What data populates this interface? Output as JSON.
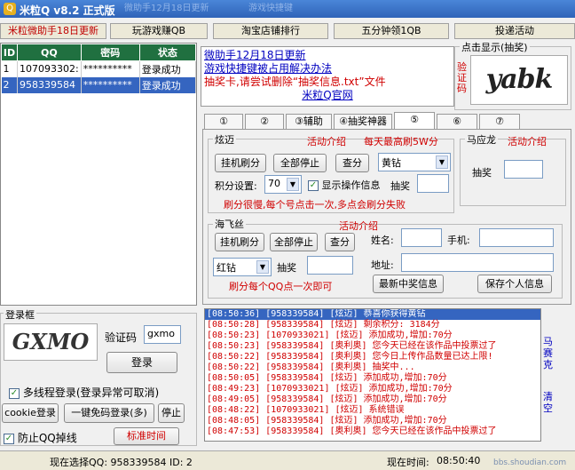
{
  "title_bar": {
    "title": "米粒Q v8.2 正式版",
    "faded_1": "微助手12月18日更新",
    "faded_2": "游戏快捷键"
  },
  "menu": [
    "米粒微助手18日更新",
    "玩游戏赚QB",
    "淘宝店铺排行",
    "五分钟领1QB",
    "投递活动"
  ],
  "grid": {
    "headers": [
      "ID",
      "QQ",
      "密码",
      "状态"
    ],
    "rows": [
      {
        "id": "1",
        "qq": "107093302:",
        "pwd": "**********",
        "status": "登录成功"
      },
      {
        "id": "2",
        "qq": "958339584",
        "pwd": "**********",
        "status": "登录成功"
      }
    ]
  },
  "notice": {
    "line1": "微助手12月18日更新",
    "line2": "游戏快捷键被占用解决办法",
    "line3": "抽奖卡,请尝试删除“抽奖信息.txt”文件",
    "line4": "米粒Q官网"
  },
  "captcha_box": {
    "title": "点击显示(抽奖)",
    "label": "验\n证\n码",
    "text": "yabk"
  },
  "tabs": [
    "①",
    "②",
    "③辅助",
    "④抽奖神器",
    "⑤",
    "⑥",
    "⑦"
  ],
  "xuanmai": {
    "title": "炫迈",
    "activity": "活动介绍",
    "max": "每天最高刷5W分",
    "btn_hang": "挂机刷分",
    "btn_stop": "全部停止",
    "btn_check": "查分",
    "select": "黄钻",
    "score_label": "积分设置:",
    "score_value": "70",
    "show_info": "显示操作信息",
    "lottery": "抽奖",
    "tip": "刷分很慢,每个号点击一次,多点会刷分失败"
  },
  "mayinglong": {
    "title": "马应龙",
    "activity": "活动介绍",
    "lottery": "抽奖"
  },
  "haifeisi": {
    "title": "海飞丝",
    "activity": "活动介绍",
    "btn_hang": "挂机刷分",
    "btn_stop": "全部停止",
    "btn_check": "查分",
    "select": "红钻",
    "lottery": "抽奖",
    "tip": "刷分每个QQ点一次即可",
    "name_label": "姓名:",
    "phone_label": "手机:",
    "addr_label": "地址:",
    "btn_latest": "最新中奖信息",
    "btn_save": "保存个人信息"
  },
  "login": {
    "title": "登录框",
    "captcha_label": "验证码",
    "captcha_value": "gxmo",
    "captcha_text": "GXMO",
    "btn_login": "登录",
    "multithread": "多线程登录(登录异常可取消)",
    "btn_cookie": "cookie登录",
    "btn_free": "一键免码登录(多)",
    "btn_stop": "停止",
    "anti_drop": "防止QQ掉线",
    "btn_time": "标准时间"
  },
  "log": [
    "[08:50:36] [958339584] [炫迈] 恭喜你获得黄钻",
    "[08:50:28] [958339584] [炫迈] 剩余积分: 3184分",
    "[08:50:23] [1070933021] [炫迈] 添加成功,增加:70分",
    "[08:50:23] [958339584] [奥利奥] 您今天已经在该作品中投票过了",
    "[08:50:22] [958339584] [奥利奥] 您今日上传作品数量已达上限!",
    "[08:50:22] [958339584] [奥利奥] 抽奖中...",
    "[08:50:05] [958339584] [炫迈] 添加成功,增加:70分",
    "[08:49:23] [1070933021] [炫迈] 添加成功,增加:70分",
    "[08:49:05] [958339584] [炫迈] 添加成功,增加:70分",
    "[08:48:22] [1070933021] [炫迈] 系统错误",
    "[08:48:05] [958339584] [炫迈] 添加成功,增加:70分",
    "[08:47:53] [958339584] [奥利奥] 您今天已经在该作品中投票过了"
  ],
  "side_links": {
    "mayinglong": "马\n赛\n克",
    "clear": "清\n空"
  },
  "status_bar": {
    "selected": "现在选择QQ: 958339584  ID: 2",
    "time_label": "现在时间:",
    "time": "08:50:40"
  },
  "watermark": "bbs.shoudian.com"
}
